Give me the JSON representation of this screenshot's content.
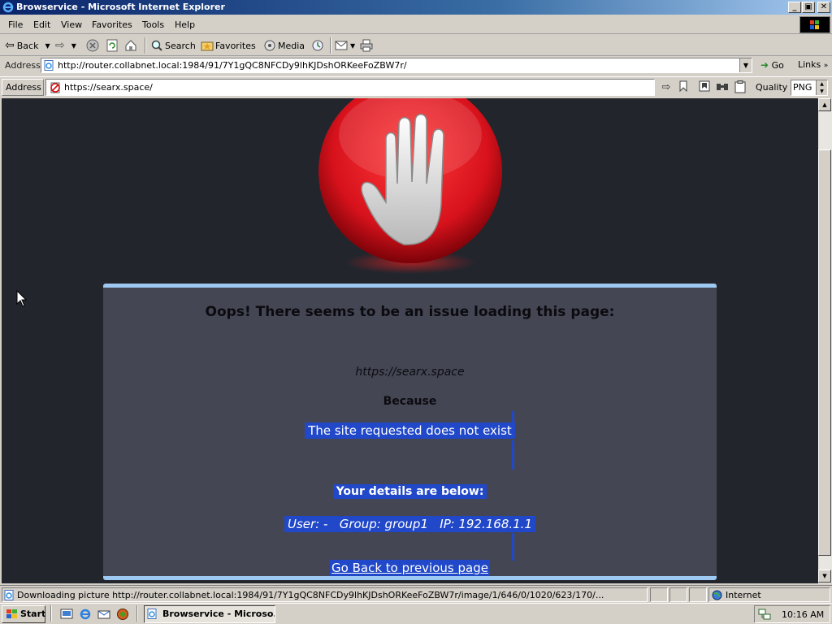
{
  "window": {
    "title": "Browservice - Microsoft Internet Explorer",
    "buttons": {
      "minimize": "_",
      "maximize": "▣",
      "close": "✕"
    }
  },
  "menu": [
    "File",
    "Edit",
    "View",
    "Favorites",
    "Tools",
    "Help"
  ],
  "toolbar": {
    "back_label": "Back",
    "search_label": "Search",
    "favorites_label": "Favorites",
    "media_label": "Media"
  },
  "address": {
    "label": "Address",
    "url": "http://router.collabnet.local:1984/91/7Y1gQC8NFCDy9lhKJDshORKeeFoZBW7r/",
    "go_label": "Go",
    "links_label": "Links"
  },
  "inner_bar": {
    "label": "Address",
    "url": "https://searx.space/",
    "quality_label": "Quality",
    "quality_value": "PNG"
  },
  "error_page": {
    "heading": "Oops! There seems to be an issue loading this page:",
    "url": "https://searx.space",
    "because": "Because",
    "reason": "The site requested does not exist",
    "details_heading": "Your details are below:",
    "user_details": "User: -   Group: group1   IP: 192.168.1.1",
    "back_link": "Go Back to previous page"
  },
  "status": {
    "text": "Downloading picture http://router.collabnet.local:1984/91/7Y1gQC8NFCDy9lhKJDshORKeeFoZBW7r/image/1/646/0/1020/623/170/...",
    "zone": "Internet"
  },
  "taskbar": {
    "start_label": "Start",
    "task_label": "Browservice - Microso...",
    "clock": "10:16 AM"
  },
  "colors": {
    "content_bg": "#23252d",
    "panel_bg": "#444654",
    "panel_border": "#9ec9f2",
    "selection": "#2048c8",
    "stop_red": "#d8121c"
  }
}
